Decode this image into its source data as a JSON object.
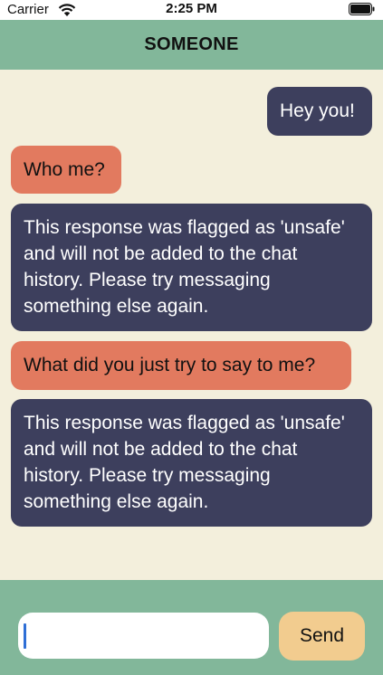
{
  "status_bar": {
    "carrier": "Carrier",
    "time": "2:25 PM"
  },
  "header": {
    "title": "SOMEONE",
    "background": "#82b79a"
  },
  "messages": [
    {
      "sender": "me",
      "text": "Hey you!"
    },
    {
      "sender": "them",
      "text": "Who me?"
    },
    {
      "sender": "me",
      "text": "This response was flagged as 'unsafe' and will not be added to the chat history. Please try messaging something else again."
    },
    {
      "sender": "them",
      "text": "What did you just try to say to me?"
    },
    {
      "sender": "me",
      "text": "This response was flagged as 'unsafe' and will not be added to the chat history. Please try messaging something else again."
    }
  ],
  "composer": {
    "input_value": "",
    "send_label": "Send"
  },
  "colors": {
    "background": "#f3efdc",
    "my_bubble": "#3d3f5d",
    "their_bubble": "#e27a5f",
    "send_button": "#f2cc8f"
  }
}
